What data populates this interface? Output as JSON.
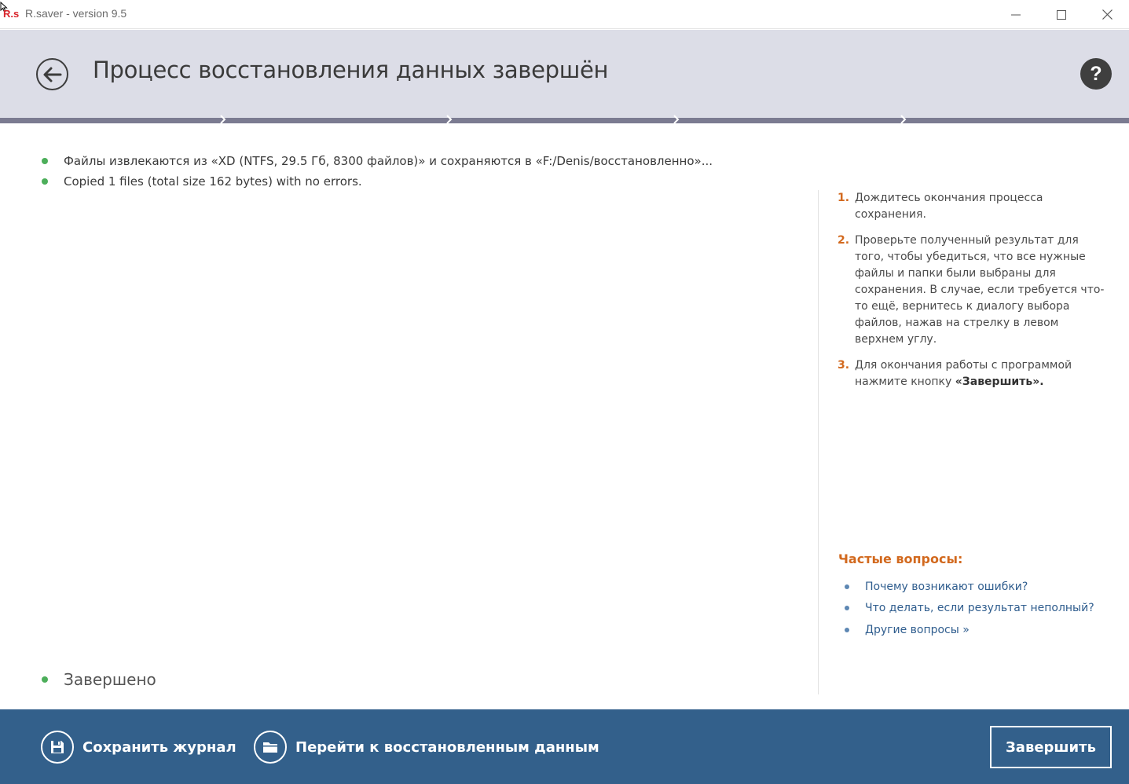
{
  "window": {
    "logo": "R.s",
    "title": "R.saver - version 9.5"
  },
  "header": {
    "title": "Процесс восстановления данных завершён",
    "help_label": "?"
  },
  "log": {
    "lines": [
      "Файлы извлекаются из «XD (NTFS, 29.5 Гб, 8300 файлов)» и сохраняются в «F:/Denis/восстановленно»...",
      "Copied 1 files (total size 162 bytes) with no errors."
    ],
    "status": "Завершено"
  },
  "side": {
    "steps": [
      {
        "num": "1.",
        "text": "Дождитесь окончания процесса сохранения."
      },
      {
        "num": "2.",
        "text": "Проверьте полученный результат для того, чтобы убедиться, что все нужные файлы и папки были выбраны для сохранения. В случае, если требуется что-то ещё, вернитесь к диалогу выбора файлов, нажав на стрелку в левом верхнем углу."
      },
      {
        "num": "3.",
        "text_before": "Для окончания работы с программой нажмите кнопку ",
        "bold": "«Завершить»."
      }
    ],
    "faq_title": "Частые вопросы:",
    "faq": [
      "Почему возникают ошибки?",
      "Что делать, если результат неполный?",
      "Другие вопросы »"
    ]
  },
  "footer": {
    "save_log_label": "Сохранить журнал",
    "goto_label": "Перейти к восстановленным данным",
    "finish_label": "Завершить"
  },
  "colors": {
    "header_bg": "#dcdde7",
    "stepbar": "#7b7b91",
    "footer_bg": "#33608b",
    "accent_orange": "#d2691e",
    "link": "#2f5d8e",
    "ok_green": "#4cae5a"
  },
  "icons": {
    "back": "arrow-left-icon",
    "help": "question-icon",
    "save": "floppy-disk-icon",
    "folder": "folder-icon"
  }
}
